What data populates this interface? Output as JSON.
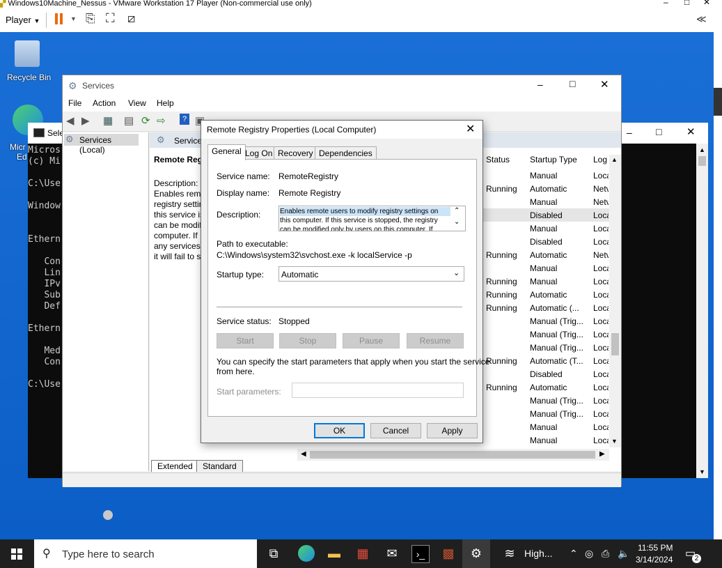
{
  "vmware": {
    "window_title": "Windows10Machine_Nessus - VMware Workstation 17 Player (Non-commercial use only)",
    "player_menu": "Player"
  },
  "desktop": {
    "recycle_bin_label": "Recycle Bin",
    "edge_label_line1": "Micr",
    "edge_label_line2": "Ed"
  },
  "console": {
    "title": "Sele",
    "lines": [
      "Micros",
      "(c) Mi",
      "",
      "C:\\Use",
      "",
      "Window",
      "",
      "",
      "Ethern",
      "",
      "   Con",
      "   Lin",
      "   IPv",
      "   Sub",
      "   Def",
      "",
      "Ethern",
      "",
      "   Med",
      "   Con",
      "",
      "C:\\Use"
    ]
  },
  "services": {
    "title": "Services",
    "menu": [
      "File",
      "Action",
      "View",
      "Help"
    ],
    "tree_item": "Services (Local)",
    "header_label": "Service",
    "selected_service_name": "Remote Reg",
    "description_heading": "Description:",
    "description_lines": [
      "Enables remo",
      "registry settin",
      "this service is",
      "can be modifi",
      "computer. If",
      "any services t",
      "it will fail to s"
    ],
    "columns": {
      "status": "Status",
      "startup": "Startup Type",
      "log": "Log"
    },
    "rows": [
      {
        "status": "",
        "startup": "Manual",
        "log": "Loca"
      },
      {
        "status": "Running",
        "startup": "Automatic",
        "log": "Netv"
      },
      {
        "status": "",
        "startup": "Manual",
        "log": "Netv"
      },
      {
        "status": "",
        "startup": "Disabled",
        "log": "Loca"
      },
      {
        "status": "",
        "startup": "Manual",
        "log": "Loca"
      },
      {
        "status": "",
        "startup": "Disabled",
        "log": "Loca"
      },
      {
        "status": "Running",
        "startup": "Automatic",
        "log": "Netv"
      },
      {
        "status": "",
        "startup": "Manual",
        "log": "Loca"
      },
      {
        "status": "Running",
        "startup": "Manual",
        "log": "Loca"
      },
      {
        "status": "Running",
        "startup": "Automatic",
        "log": "Loca"
      },
      {
        "status": "Running",
        "startup": "Automatic (...",
        "log": "Loca"
      },
      {
        "status": "",
        "startup": "Manual (Trig...",
        "log": "Loca"
      },
      {
        "status": "",
        "startup": "Manual (Trig...",
        "log": "Loca"
      },
      {
        "status": "",
        "startup": "Manual (Trig...",
        "log": "Loca"
      },
      {
        "status": "Running",
        "startup": "Automatic (T...",
        "log": "Loca"
      },
      {
        "status": "",
        "startup": "Disabled",
        "log": "Loca"
      },
      {
        "status": "Running",
        "startup": "Automatic",
        "log": "Loca"
      },
      {
        "status": "",
        "startup": "Manual (Trig...",
        "log": "Loca"
      },
      {
        "status": "",
        "startup": "Manual (Trig...",
        "log": "Loca"
      },
      {
        "status": "",
        "startup": "Manual",
        "log": "Loca"
      },
      {
        "status": "",
        "startup": "Manual",
        "log": "Loca"
      }
    ],
    "tabs_bottom": [
      "Extended",
      "Standard"
    ]
  },
  "dialog": {
    "title": "Remote Registry Properties (Local Computer)",
    "tabs": [
      "General",
      "Log On",
      "Recovery",
      "Dependencies"
    ],
    "service_name_label": "Service name:",
    "service_name_value": "RemoteRegistry",
    "display_name_label": "Display name:",
    "display_name_value": "Remote Registry",
    "description_label": "Description:",
    "description_lines": [
      "Enables remote users to modify registry settings on",
      "this computer. If this service is stopped, the registry",
      "can be modified only by users on this computer. If"
    ],
    "path_label": "Path to executable:",
    "path_value": "C:\\Windows\\system32\\svchost.exe -k localService -p",
    "startup_type_label": "Startup type:",
    "startup_type_value": "Automatic",
    "service_status_label": "Service status:",
    "service_status_value": "Stopped",
    "buttons": {
      "start": "Start",
      "stop": "Stop",
      "pause": "Pause",
      "resume": "Resume"
    },
    "hint_line1": "You can specify the start parameters that apply when you start the service",
    "hint_line2": "from here.",
    "start_params_label": "Start parameters:",
    "footer": {
      "ok": "OK",
      "cancel": "Cancel",
      "apply": "Apply"
    }
  },
  "taskbar": {
    "search_placeholder": "Type here to search",
    "pinned_label": "High...",
    "time": "11:55 PM",
    "date": "3/14/2024",
    "notification_count": "2"
  }
}
